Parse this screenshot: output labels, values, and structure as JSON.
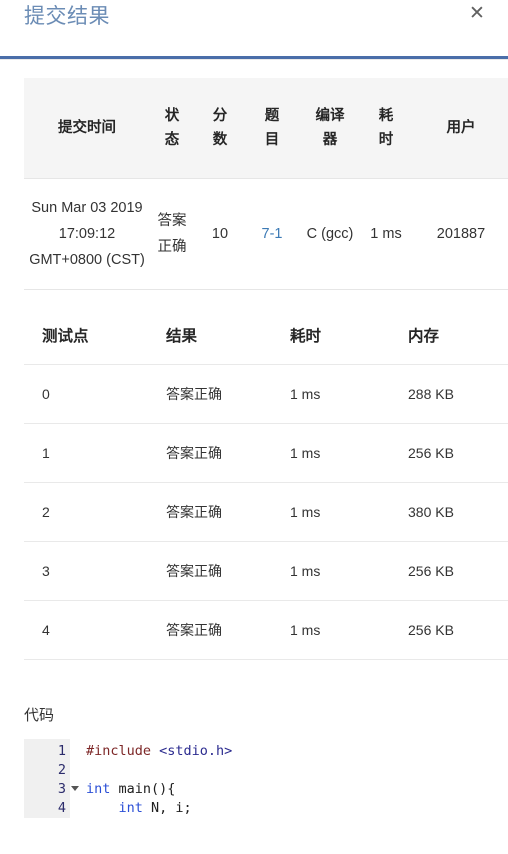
{
  "modal": {
    "title": "提交结果",
    "close_icon": "close-icon",
    "close_label": "✕"
  },
  "submission_table": {
    "headers": {
      "time": "提交时间",
      "status": "状\n态",
      "status_line1": "状",
      "status_line2": "态",
      "score_line1": "分",
      "score_line2": "数",
      "problem_line1": "题",
      "problem_line2": "目",
      "compiler_line1": "编译",
      "compiler_line2": "器",
      "duration_line1": "耗",
      "duration_line2": "时",
      "user": "用户"
    },
    "rows": [
      {
        "time": "Sun Mar 03 2019 17:09:12 GMT+0800 (CST)",
        "status": "答案正确",
        "score": "10",
        "problem": "7-1",
        "compiler": "C (gcc)",
        "duration": "1 ms",
        "user": "201887"
      }
    ]
  },
  "testpoint_table": {
    "headers": {
      "id": "测试点",
      "result": "结果",
      "duration": "耗时",
      "memory": "内存"
    },
    "rows": [
      {
        "id": "0",
        "result": "答案正确",
        "duration": "1 ms",
        "memory": "288 KB"
      },
      {
        "id": "1",
        "result": "答案正确",
        "duration": "1 ms",
        "memory": "256 KB"
      },
      {
        "id": "2",
        "result": "答案正确",
        "duration": "1 ms",
        "memory": "380 KB"
      },
      {
        "id": "3",
        "result": "答案正确",
        "duration": "1 ms",
        "memory": "256 KB"
      },
      {
        "id": "4",
        "result": "答案正确",
        "duration": "1 ms",
        "memory": "256 KB"
      }
    ]
  },
  "code_section": {
    "label": "代码",
    "line_numbers": [
      "1",
      "2",
      "3",
      "4"
    ],
    "fold_line": "3",
    "lines": [
      {
        "num": "1",
        "tokens": [
          {
            "t": "#include ",
            "c": "tok-pre"
          },
          {
            "t": "<stdio.h>",
            "c": "tok-inc"
          }
        ]
      },
      {
        "num": "2",
        "tokens": [
          {
            "t": "",
            "c": "tok-pln"
          }
        ]
      },
      {
        "num": "3",
        "tokens": [
          {
            "t": "int",
            "c": "tok-kw"
          },
          {
            "t": " main(){",
            "c": "tok-pln"
          }
        ]
      },
      {
        "num": "4",
        "tokens": [
          {
            "t": "    ",
            "c": "tok-pln"
          },
          {
            "t": "int",
            "c": "tok-kw"
          },
          {
            "t": " N, i;",
            "c": "tok-pln"
          }
        ]
      }
    ]
  },
  "colors": {
    "title_blue": "#6b8cb5",
    "rule_blue": "#4a6ea9",
    "status_red": "#e2625d",
    "link_blue": "#3c7ab5",
    "header_bg": "#f5f5f5",
    "gutter_bg": "#f0f0f0"
  }
}
